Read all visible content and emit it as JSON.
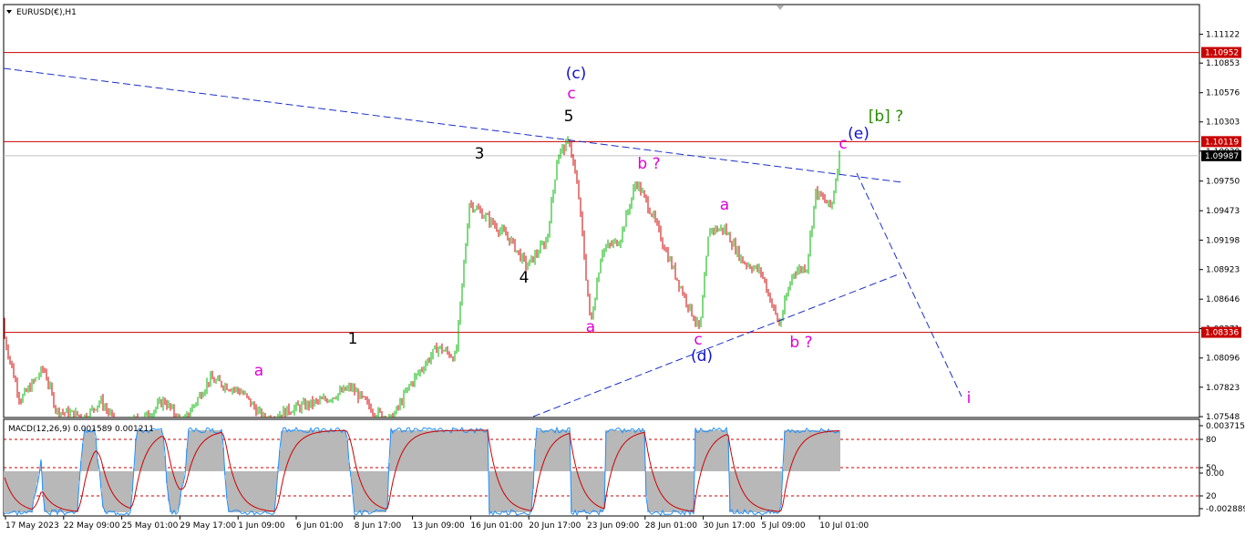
{
  "header": {
    "symbol": "EURUSD(€),H1"
  },
  "macd": {
    "label": "MACD(12,26,9) 0.001589 0.001211"
  },
  "colors": {
    "up": "#00b400",
    "down": "#d20000",
    "level": "#c80000",
    "trend": "#1a2fc8",
    "magenta": "#e000d8",
    "blue": "#1010d0",
    "green": "#2a8a00"
  },
  "chart_data": {
    "type": "candlestick",
    "ylim": [
      1.0754,
      1.114
    ],
    "price_ticks": [
      "1.11122",
      "1.10853",
      "1.10576",
      "1.10303",
      "1.10030",
      "1.09750",
      "1.09473",
      "1.09198",
      "1.08923",
      "1.08646",
      "1.08371",
      "1.08096",
      "1.07823",
      "1.07548"
    ],
    "date_labels": [
      "17 May 2023",
      "22 May 09:00",
      "25 May 01:00",
      "29 May 17:00",
      "1 Jun 09:00",
      "6 Jun 01:00",
      "8 Jun 17:00",
      "13 Jun 09:00",
      "16 Jun 01:00",
      "20 Jun 17:00",
      "23 Jun 09:00",
      "28 Jun 01:00",
      "30 Jun 17:00",
      "5 Jul 09:00",
      "10 Jul 01:00"
    ],
    "levels": [
      {
        "price": 1.10952,
        "label": "1.10952"
      },
      {
        "price": 1.10119,
        "label": "1.10119"
      },
      {
        "price": 1.08336,
        "label": "1.08336"
      }
    ],
    "current_price": {
      "price": 1.09987,
      "label": "1.09987"
    },
    "waypoints": [
      [
        0,
        1.0845
      ],
      [
        22,
        1.077
      ],
      [
        48,
        1.08
      ],
      [
        62,
        1.076
      ],
      [
        95,
        1.0755
      ],
      [
        110,
        1.077
      ],
      [
        130,
        1.0745
      ],
      [
        160,
        1.0755
      ],
      [
        180,
        1.077
      ],
      [
        200,
        1.0748
      ],
      [
        230,
        1.079
      ],
      [
        265,
        1.0778
      ],
      [
        290,
        1.0752
      ],
      [
        320,
        1.0762
      ],
      [
        355,
        1.077
      ],
      [
        385,
        1.0782
      ],
      [
        410,
        1.076
      ],
      [
        430,
        1.0752
      ],
      [
        450,
        1.0785
      ],
      [
        480,
        1.082
      ],
      [
        500,
        1.081
      ],
      [
        515,
        1.0955
      ],
      [
        535,
        1.094
      ],
      [
        560,
        1.092
      ],
      [
        578,
        1.0895
      ],
      [
        600,
        1.092
      ],
      [
        612,
        1.1
      ],
      [
        625,
        1.1012
      ],
      [
        635,
        1.096
      ],
      [
        648,
        1.084
      ],
      [
        660,
        1.091
      ],
      [
        680,
        1.092
      ],
      [
        698,
        1.0975
      ],
      [
        715,
        1.0945
      ],
      [
        735,
        1.09
      ],
      [
        752,
        1.0865
      ],
      [
        768,
        1.0835
      ],
      [
        778,
        1.093
      ],
      [
        795,
        1.093
      ],
      [
        815,
        1.09
      ],
      [
        835,
        1.089
      ],
      [
        855,
        1.084
      ],
      [
        870,
        1.089
      ],
      [
        885,
        1.0895
      ],
      [
        895,
        1.0965
      ],
      [
        912,
        1.095
      ],
      [
        922,
        1.1005
      ]
    ],
    "macd_ticks": [
      "0.003715",
      "80",
      "50",
      "0.00",
      "20",
      "-0.002889"
    ],
    "annotations": [
      {
        "text": "(c)",
        "color": "blue"
      },
      {
        "text": "c",
        "color": "magenta"
      },
      {
        "text": "5",
        "color": "black"
      },
      {
        "text": "3",
        "color": "black"
      },
      {
        "text": "4",
        "color": "black"
      },
      {
        "text": "1",
        "color": "black"
      },
      {
        "text": "a",
        "color": "magenta"
      },
      {
        "text": "a",
        "color": "magenta"
      },
      {
        "text": "b ?",
        "color": "magenta"
      },
      {
        "text": "a",
        "color": "magenta"
      },
      {
        "text": "c",
        "color": "magenta"
      },
      {
        "text": "(d)",
        "color": "blue"
      },
      {
        "text": "b ?",
        "color": "magenta"
      },
      {
        "text": "c",
        "color": "magenta"
      },
      {
        "text": "(e)",
        "color": "blue"
      },
      {
        "text": "[b] ?",
        "color": "green"
      },
      {
        "text": "i",
        "color": "magenta"
      }
    ]
  }
}
